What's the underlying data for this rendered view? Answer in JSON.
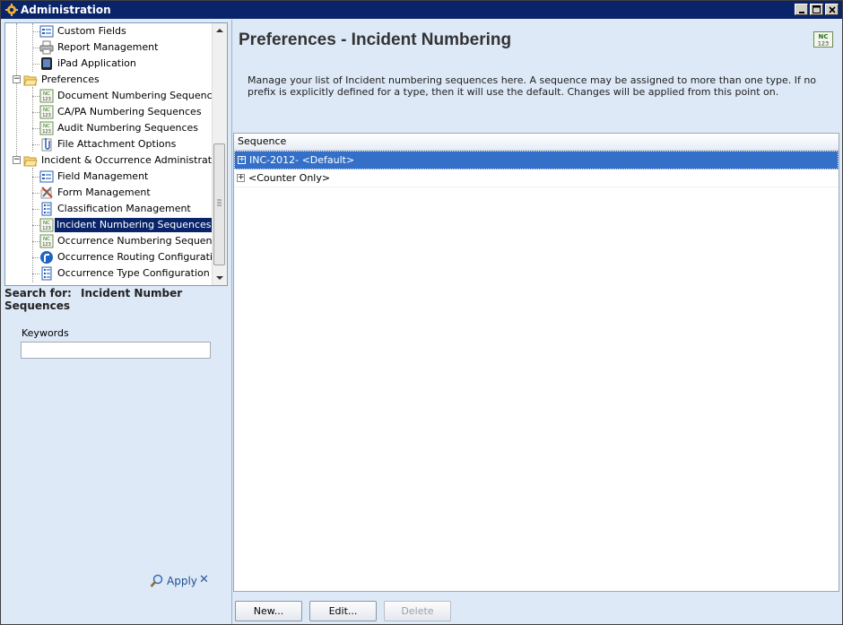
{
  "window": {
    "title": "Administration"
  },
  "tree": {
    "items": [
      {
        "label": "Custom Fields",
        "icon": "form-list-icon",
        "level": 2
      },
      {
        "label": "Report Management",
        "icon": "printer-icon",
        "level": 2
      },
      {
        "label": "iPad Application",
        "icon": "tablet-icon",
        "level": 2
      },
      {
        "label": "Preferences",
        "icon": "folder-open-icon",
        "level": 1,
        "toggle": "-"
      },
      {
        "label": "Document Numbering Sequences",
        "icon": "nc-number-icon",
        "level": 2
      },
      {
        "label": "CA/PA Numbering Sequences",
        "icon": "nc-number-icon",
        "level": 2
      },
      {
        "label": "Audit Numbering Sequences",
        "icon": "nc-number-icon",
        "level": 2
      },
      {
        "label": "File Attachment Options",
        "icon": "paperclip-icon",
        "level": 2
      },
      {
        "label": "Incident & Occurrence Administration",
        "icon": "folder-open-icon",
        "level": 1,
        "toggle": "-"
      },
      {
        "label": "Field Management",
        "icon": "form-list-icon",
        "level": 2
      },
      {
        "label": "Form Management",
        "icon": "tools-icon",
        "level": 2
      },
      {
        "label": "Classification Management",
        "icon": "list-icon",
        "level": 2
      },
      {
        "label": "Incident Numbering Sequences",
        "icon": "nc-number-icon",
        "level": 2,
        "selected": true
      },
      {
        "label": "Occurrence Numbering Sequences",
        "icon": "nc-number-icon",
        "level": 2
      },
      {
        "label": "Occurrence Routing Configuration",
        "icon": "routing-icon",
        "level": 2
      },
      {
        "label": "Occurrence Type Configuration",
        "icon": "list-icon",
        "level": 2
      }
    ]
  },
  "search": {
    "label": "Search for:",
    "value": "Incident Number Sequences",
    "keywords_label": "Keywords",
    "keywords_value": "",
    "apply_label": "Apply",
    "clear_label": "✕"
  },
  "main": {
    "title": "Preferences - Incident Numbering",
    "badge_top": "NC",
    "badge_bottom": "123",
    "description": "Manage your list of Incident numbering sequences here. A sequence may be assigned to more than one type. If no prefix is explicitly defined for a type, then it will use the default. Changes will be applied from this point on.",
    "grid": {
      "column": "Sequence",
      "rows": [
        {
          "label": "INC-2012- <Default>",
          "selected": true
        },
        {
          "label": "<Counter Only>",
          "selected": false
        }
      ]
    },
    "buttons": {
      "new": "New...",
      "edit": "Edit...",
      "delete": "Delete"
    }
  },
  "colors": {
    "titlebar": "#0a246a",
    "selection": "#0a246a",
    "grid_selection": "#3470c8",
    "panel": "#dde9f7"
  }
}
